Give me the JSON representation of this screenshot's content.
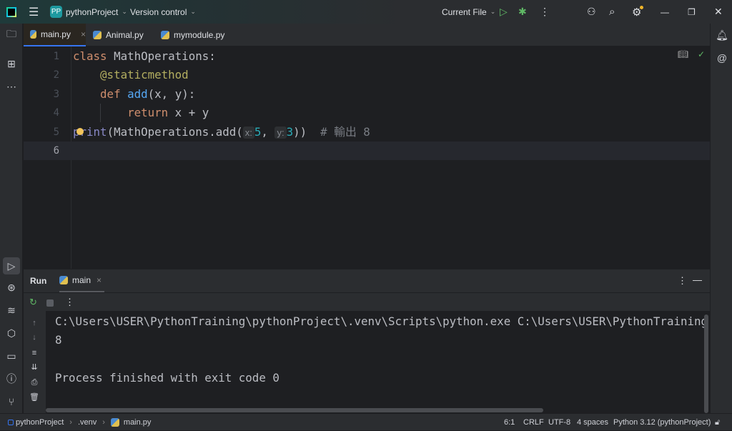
{
  "titlebar": {
    "project_badge": "PP",
    "project": "pythonProject",
    "vcs": "Version control",
    "run_config": "Current File"
  },
  "tabs": [
    {
      "label": "main.py",
      "active": true
    },
    {
      "label": "Animal.py"
    },
    {
      "label": "mymodule.py"
    }
  ],
  "editor": {
    "line_numbers": [
      "1",
      "2",
      "3",
      "4",
      "5",
      "6"
    ],
    "lines": {
      "l1": {
        "kw": "class",
        "rest": " MathOperations:"
      },
      "l2": {
        "indent": "    ",
        "dec": "@staticmethod"
      },
      "l3": {
        "indent": "    ",
        "kw": "def",
        "sp": " ",
        "fn": "add",
        "rest": "(x, y):"
      },
      "l4": {
        "indent": "        ",
        "kw": "return",
        "rest": " x + y"
      },
      "l5": {
        "bi": "print",
        "a": "(MathOperations.add(",
        "hx": "x:",
        "n1": "5",
        "b": ", ",
        "hy": "y:",
        "n2": "3",
        "c": "))  ",
        "cm": "# 輸出 8"
      }
    }
  },
  "run": {
    "tab_title": "Run",
    "config_tab": "main",
    "output": [
      "C:\\Users\\USER\\PythonTraining\\pythonProject\\.venv\\Scripts\\python.exe C:\\Users\\USER\\PythonTraining",
      "8",
      "",
      "Process finished with exit code 0"
    ]
  },
  "status": {
    "breadcrumb": [
      "pythonProject",
      ".venv",
      "main.py"
    ],
    "position": "6:1",
    "line_sep": "CRLF",
    "encoding": "UTF-8",
    "indent": "4 spaces",
    "interpreter": "Python 3.12 (pythonProject)"
  },
  "colors": {
    "accent": "#3574f0",
    "run_green": "#5fb865",
    "keyword": "#cf8e6d",
    "function": "#56a8f5",
    "number": "#2aacb8",
    "decorator": "#b3ae60"
  }
}
